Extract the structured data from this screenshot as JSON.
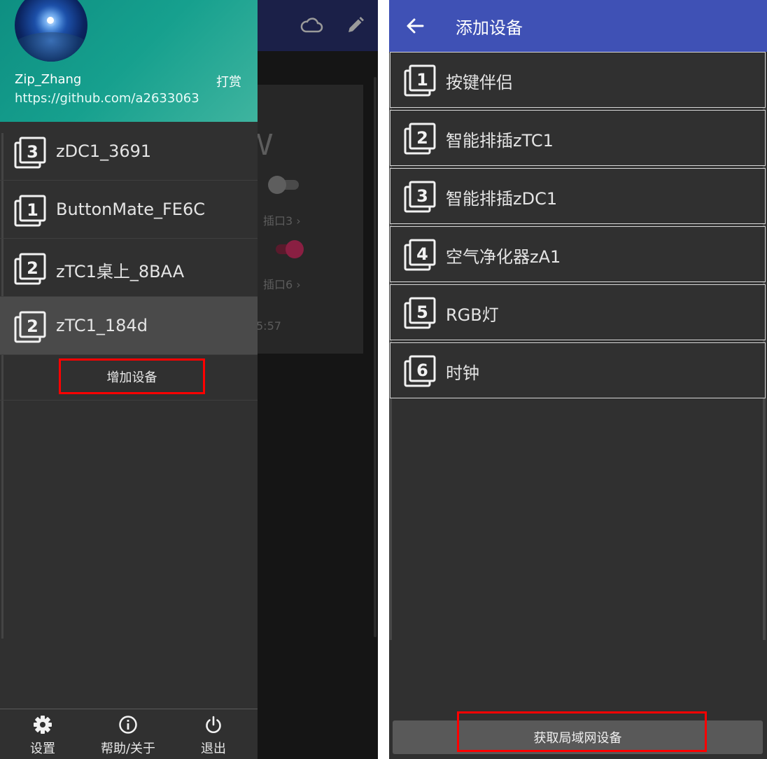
{
  "colors": {
    "drawer_header": "#16a08e",
    "appbar": "#3f51b5",
    "highlight": "#ff0000",
    "background": "#303030"
  },
  "background_app": {
    "partial_letter": "W",
    "outlet3_label": "插口3 ›",
    "outlet6_label": "插口6 ›",
    "time_fragment": "5:57",
    "icons": [
      "cloud-icon",
      "pencil-icon"
    ]
  },
  "drawer": {
    "user_name": "Zip_Zhang",
    "tip_label": "打赏",
    "user_url": "https://github.com/a2633063",
    "devices": [
      {
        "icon_number": "3",
        "label": "zDC1_3691"
      },
      {
        "icon_number": "1",
        "label": "ButtonMate_FE6C"
      },
      {
        "icon_number": "2",
        "label": "zTC1桌上_8BAA"
      },
      {
        "icon_number": "2",
        "label": "zTC1_184d",
        "selected": true
      }
    ],
    "add_device_label": "增加设备",
    "bottom_nav": [
      {
        "icon": "gear-icon",
        "label": "设置"
      },
      {
        "icon": "info-icon",
        "label": "帮助/关于"
      },
      {
        "icon": "power-icon",
        "label": "退出"
      }
    ]
  },
  "add_device_screen": {
    "title": "添加设备",
    "types": [
      {
        "icon_number": "1",
        "label": "按键伴侣"
      },
      {
        "icon_number": "2",
        "label": "智能排插zTC1"
      },
      {
        "icon_number": "3",
        "label": "智能排插zDC1"
      },
      {
        "icon_number": "4",
        "label": "空气净化器zA1"
      },
      {
        "icon_number": "5",
        "label": "RGB灯"
      },
      {
        "icon_number": "6",
        "label": "时钟"
      }
    ],
    "lan_button_label": "获取局域网设备"
  }
}
